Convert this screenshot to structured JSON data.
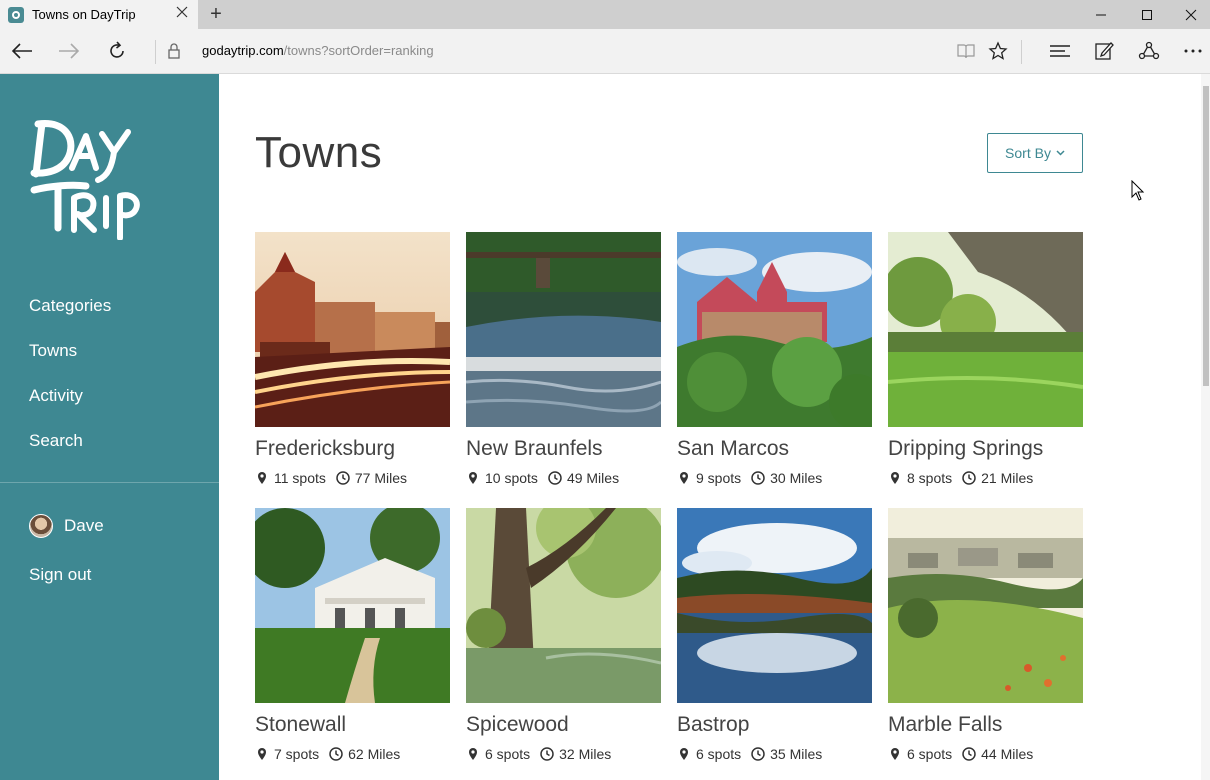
{
  "browser": {
    "tab_title": "Towns on DayTrip",
    "url_domain": "godaytrip.com",
    "url_path": "/towns?sortOrder=ranking",
    "new_tab": "+"
  },
  "sidebar": {
    "logo_text": "DayTrip",
    "nav": [
      {
        "label": "Categories"
      },
      {
        "label": "Towns"
      },
      {
        "label": "Activity"
      },
      {
        "label": "Search"
      }
    ],
    "user_name": "Dave",
    "sign_out": "Sign out"
  },
  "page": {
    "title": "Towns",
    "sort_label": "Sort By"
  },
  "towns": [
    {
      "name": "Fredericksburg",
      "spots": "11 spots",
      "miles": "77 Miles"
    },
    {
      "name": "New Braunfels",
      "spots": "10 spots",
      "miles": "49 Miles"
    },
    {
      "name": "San Marcos",
      "spots": "9 spots",
      "miles": "30 Miles"
    },
    {
      "name": "Dripping Springs",
      "spots": "8 spots",
      "miles": "21 Miles"
    },
    {
      "name": "Stonewall",
      "spots": "7 spots",
      "miles": "62 Miles"
    },
    {
      "name": "Spicewood",
      "spots": "6 spots",
      "miles": "32 Miles"
    },
    {
      "name": "Bastrop",
      "spots": "6 spots",
      "miles": "35 Miles"
    },
    {
      "name": "Marble Falls",
      "spots": "6 spots",
      "miles": "44 Miles"
    }
  ],
  "colors": {
    "sidebar": "#3e8892",
    "accent": "#3e8892"
  }
}
